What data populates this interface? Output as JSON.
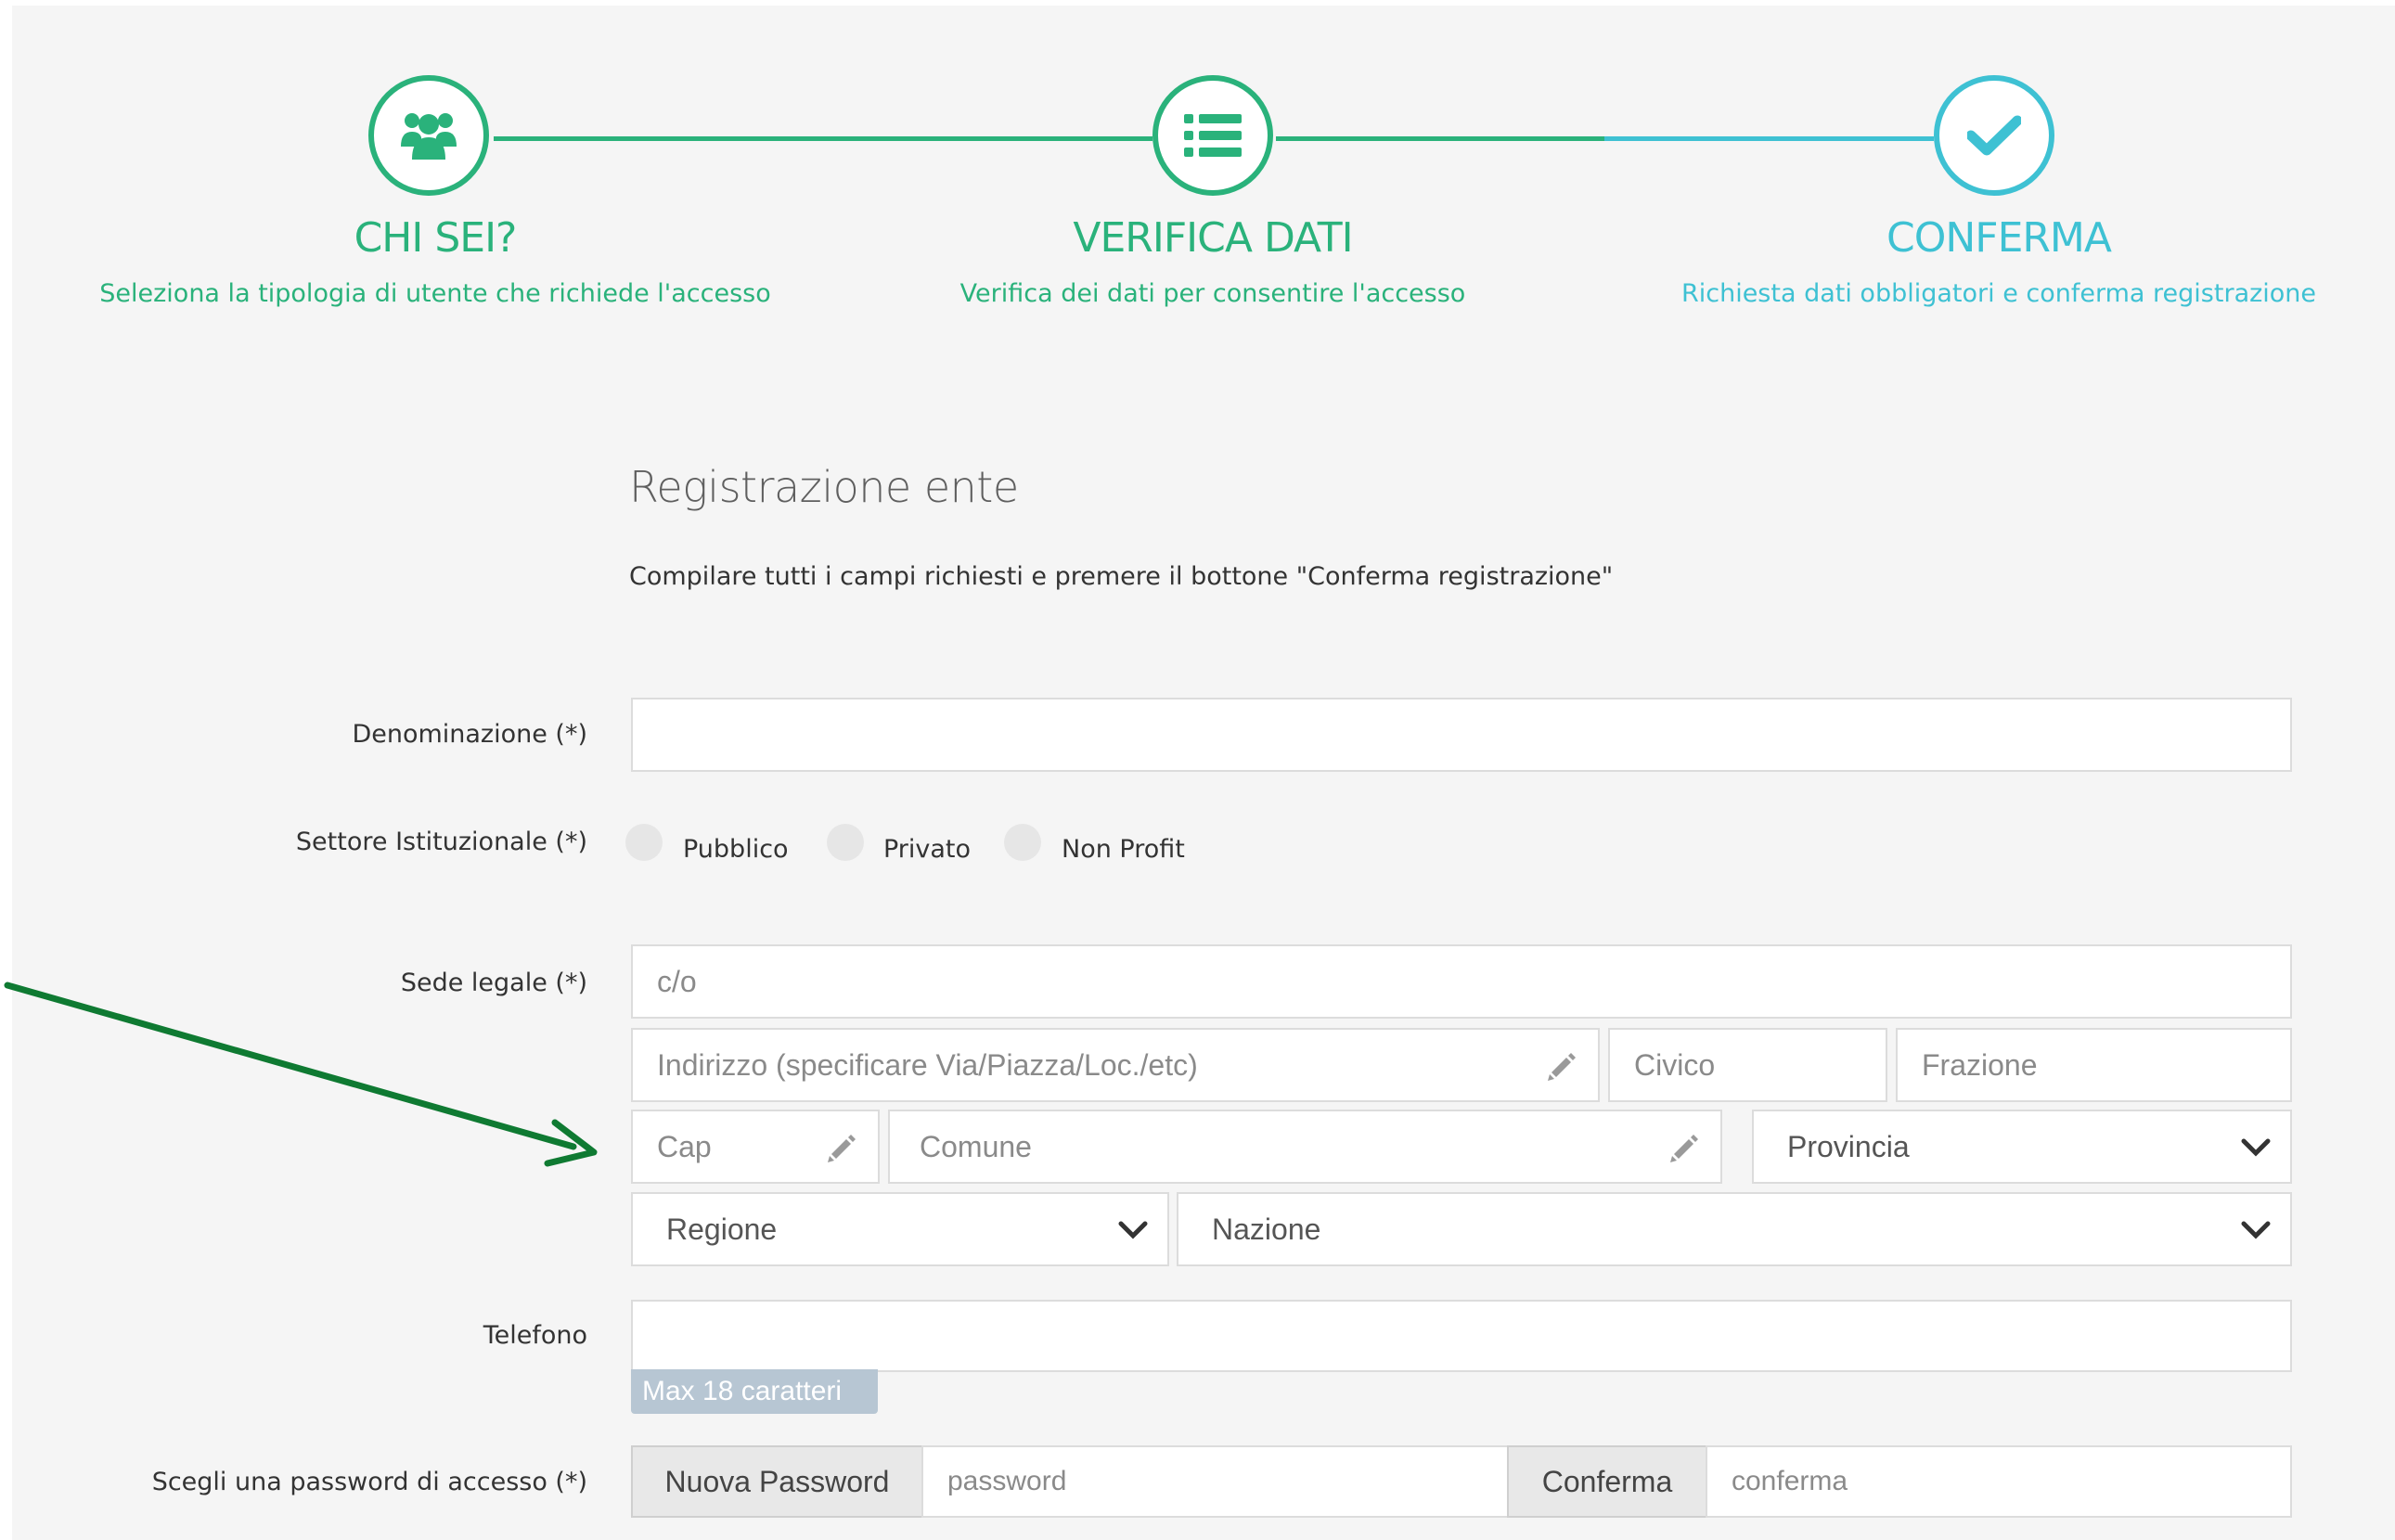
{
  "wizard": {
    "steps": [
      {
        "title": "CHI SEI?",
        "subtitle": "Seleziona la tipologia di utente che richiede l'accesso",
        "icon": "users-icon"
      },
      {
        "title": "VERIFICA DATI",
        "subtitle": "Verifica dei dati per consentire l'accesso",
        "icon": "list-icon"
      },
      {
        "title": "CONFERMA",
        "subtitle": "Richiesta dati obbligatori e conferma registrazione",
        "icon": "check-icon"
      }
    ],
    "colors": {
      "completed": "#2ab27b",
      "current": "#3ec1d3"
    }
  },
  "form": {
    "heading": "Registrazione ente",
    "instructions": "Compilare tutti i campi richiesti e premere il bottone \"Conferma registrazione\"",
    "denominazione": {
      "label": "Denominazione (*)",
      "value": ""
    },
    "settore": {
      "label": "Settore Istituzionale (*)",
      "options": [
        "Pubblico",
        "Privato",
        "Non Profit"
      ]
    },
    "sede": {
      "label": "Sede legale (*)",
      "co_placeholder": "c/o",
      "indirizzo_placeholder": "Indirizzo (specificare Via/Piazza/Loc./etc)",
      "civico_placeholder": "Civico",
      "frazione_placeholder": "Frazione",
      "cap_placeholder": "Cap",
      "comune_placeholder": "Comune",
      "provincia_selected": "Provincia",
      "regione_selected": "Regione",
      "nazione_selected": "Nazione"
    },
    "telefono": {
      "label": "Telefono",
      "value": "",
      "hint": "Max 18 caratteri"
    },
    "password": {
      "label": "Scegli una password di accesso (*)",
      "new_addon": "Nuova Password",
      "new_placeholder": "password",
      "confirm_addon": "Conferma",
      "confirm_placeholder": "conferma"
    }
  },
  "annotation": {
    "color": "#0f7a32"
  }
}
